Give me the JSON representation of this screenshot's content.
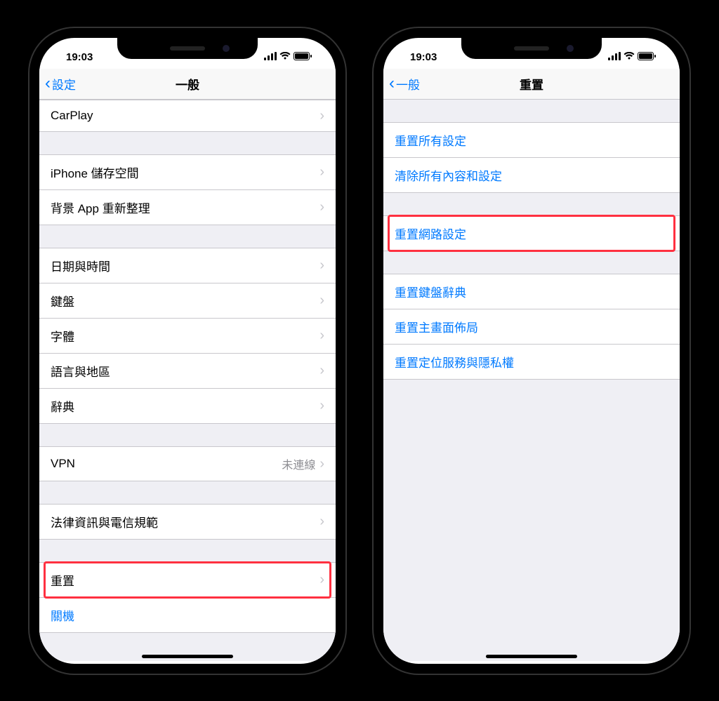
{
  "status": {
    "time": "19:03"
  },
  "left": {
    "back_label": "設定",
    "title": "一般",
    "groups": [
      {
        "first": true,
        "items": [
          {
            "label": "CarPlay",
            "disclosure": true
          }
        ]
      },
      {
        "items": [
          {
            "label": "iPhone 儲存空間",
            "disclosure": true
          },
          {
            "label": "背景 App 重新整理",
            "disclosure": true
          }
        ]
      },
      {
        "items": [
          {
            "label": "日期與時間",
            "disclosure": true
          },
          {
            "label": "鍵盤",
            "disclosure": true
          },
          {
            "label": "字體",
            "disclosure": true
          },
          {
            "label": "語言與地區",
            "disclosure": true
          },
          {
            "label": "辭典",
            "disclosure": true
          }
        ]
      },
      {
        "items": [
          {
            "label": "VPN",
            "detail": "未連線",
            "disclosure": true
          }
        ]
      },
      {
        "items": [
          {
            "label": "法律資訊與電信規範",
            "disclosure": true
          }
        ]
      },
      {
        "items": [
          {
            "label": "重置",
            "disclosure": true,
            "highlight": true
          },
          {
            "label": "關機",
            "blue": true
          }
        ]
      }
    ]
  },
  "right": {
    "back_label": "一般",
    "title": "重置",
    "groups": [
      {
        "items": [
          {
            "label": "重置所有設定",
            "blue": true
          },
          {
            "label": "清除所有內容和設定",
            "blue": true
          }
        ]
      },
      {
        "items": [
          {
            "label": "重置網路設定",
            "blue": true,
            "highlight": true
          }
        ]
      },
      {
        "items": [
          {
            "label": "重置鍵盤辭典",
            "blue": true
          },
          {
            "label": "重置主畫面佈局",
            "blue": true
          },
          {
            "label": "重置定位服務與隱私權",
            "blue": true
          }
        ]
      }
    ]
  }
}
